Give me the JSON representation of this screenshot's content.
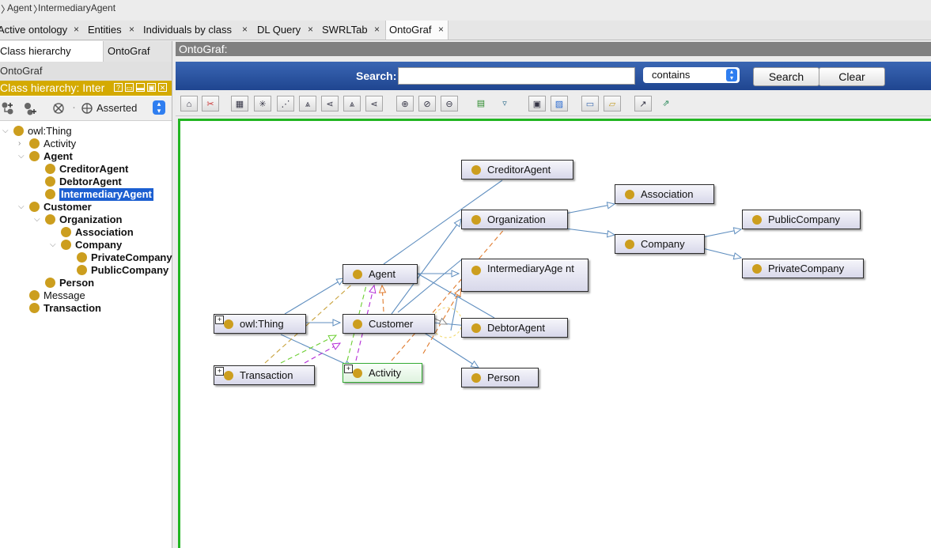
{
  "breadcrumb": {
    "items": [
      "Agent",
      "IntermediaryAgent"
    ]
  },
  "tabs": [
    {
      "label": "Active ontology"
    },
    {
      "label": "Entities"
    },
    {
      "label": "Individuals by class"
    },
    {
      "label": "DL Query"
    },
    {
      "label": "SWRLTab"
    },
    {
      "label": "OntoGraf",
      "active": true
    }
  ],
  "close_glyph": "×",
  "left_panel": {
    "subtabs": [
      "Class hierarchy",
      "OntoGraf"
    ],
    "ontograf_label": "OntoGraf",
    "header": "Class hierarchy: Inter",
    "header_buttons": [
      "?",
      "▭",
      "▬",
      "▣",
      "✕"
    ],
    "asserted": "Asserted",
    "tree": [
      {
        "label": "owl:Thing",
        "depth": 0,
        "bold": false,
        "arrow": "open"
      },
      {
        "label": "Activity",
        "depth": 1,
        "bold": false,
        "arrow": "closed"
      },
      {
        "label": "Agent",
        "depth": 1,
        "bold": true,
        "arrow": "open"
      },
      {
        "label": "CreditorAgent",
        "depth": 2,
        "bold": true,
        "arrow": ""
      },
      {
        "label": "DebtorAgent",
        "depth": 2,
        "bold": true,
        "arrow": ""
      },
      {
        "label": "IntermediaryAgent",
        "depth": 2,
        "bold": true,
        "arrow": "",
        "selected": true
      },
      {
        "label": "Customer",
        "depth": 1,
        "bold": true,
        "arrow": "open"
      },
      {
        "label": "Organization",
        "depth": 2,
        "bold": true,
        "arrow": "open"
      },
      {
        "label": "Association",
        "depth": 3,
        "bold": true,
        "arrow": ""
      },
      {
        "label": "Company",
        "depth": 3,
        "bold": true,
        "arrow": "open"
      },
      {
        "label": "PrivateCompany",
        "depth": 4,
        "bold": true,
        "arrow": ""
      },
      {
        "label": "PublicCompany",
        "depth": 4,
        "bold": true,
        "arrow": ""
      },
      {
        "label": "Person",
        "depth": 2,
        "bold": true,
        "arrow": ""
      },
      {
        "label": "Message",
        "depth": 1,
        "bold": false,
        "arrow": ""
      },
      {
        "label": "Transaction",
        "depth": 1,
        "bold": true,
        "arrow": ""
      }
    ]
  },
  "ontograf": {
    "title": "OntoGraf:",
    "search_label": "Search:",
    "search_value": "",
    "match_mode": "contains",
    "search_button": "Search",
    "clear_button": "Clear"
  },
  "graph": {
    "nodes": [
      {
        "id": "creditor",
        "label": "CreditorAgent"
      },
      {
        "id": "association",
        "label": "Association"
      },
      {
        "id": "organization",
        "label": "Organization"
      },
      {
        "id": "publiccompany",
        "label": "PublicCompany"
      },
      {
        "id": "company",
        "label": "Company"
      },
      {
        "id": "intermediary",
        "label": "IntermediaryAge nt"
      },
      {
        "id": "privatecompany",
        "label": "PrivateCompany"
      },
      {
        "id": "agent",
        "label": "Agent"
      },
      {
        "id": "owlthing",
        "label": "owl:Thing",
        "expandable": true
      },
      {
        "id": "customer",
        "label": "Customer"
      },
      {
        "id": "debtor",
        "label": "DebtorAgent"
      },
      {
        "id": "transaction",
        "label": "Transaction",
        "expandable": true
      },
      {
        "id": "activity",
        "label": "Activity",
        "expandable": true,
        "highlighted": true
      },
      {
        "id": "person",
        "label": "Person"
      }
    ],
    "colors": {
      "subclass_edge": "#5f8ebf",
      "orange_edge": "#e07a2c",
      "purple_edge": "#b32bd6",
      "green_edge": "#6ccf32",
      "tan_edge": "#c8a13a",
      "node_dot": "#cc9e1e",
      "canvas_border": "#22b522"
    }
  }
}
